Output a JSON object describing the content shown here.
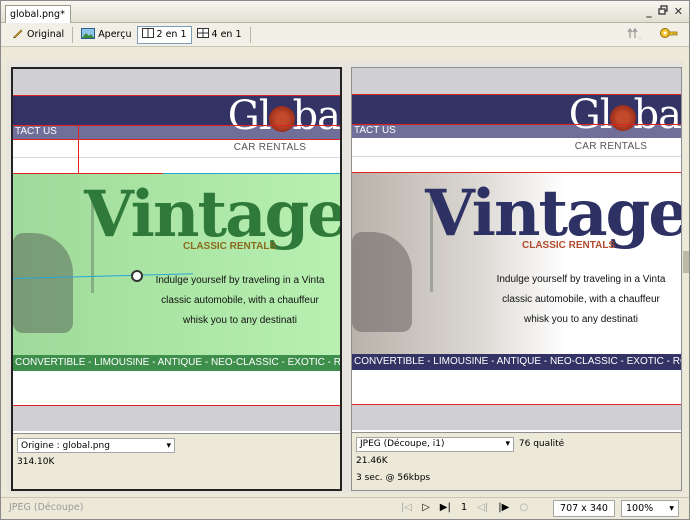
{
  "window": {
    "tab_title": "global.png*",
    "minimize": "-",
    "restore": " ̸",
    "close": "×"
  },
  "toolbar": {
    "original": "Original",
    "apercu": "Aperçu",
    "two_up": "2 en 1",
    "four_up": "4 en 1",
    "active_view": "2 en 1"
  },
  "panes": {
    "left": {
      "format_select": "Origine : global.png",
      "size": "314.10K",
      "quality": "",
      "time": ""
    },
    "right": {
      "format_select": "JPEG (Découpe, i1)",
      "quality": "76 qualité",
      "size": "21.46K",
      "time": "3 sec. @ 56kbps"
    }
  },
  "preview": {
    "logo_prefix": "Gl",
    "logo_suffix": "ba",
    "contact": "TACT US",
    "car_rentals": "CAR RENTALS",
    "vintage": "Vintage",
    "classic": "CLASSIC RENTALS",
    "copy_line1": "Indulge yourself by traveling in a Vinta",
    "copy_line2": "classic automobile, with a chauffeur",
    "copy_line3": "whisk you to any destinati",
    "strip": "CONVERTIBLE - LIMOUSINE - ANTIQUE - NEO-CLASSIC - EXOTIC - ROADST"
  },
  "statusbar": {
    "status": "JPEG (Découpe)",
    "frame": "1",
    "dimensions": "707 x 340",
    "zoom": "100%"
  },
  "colors": {
    "navy": "#333366",
    "green_overlay": "#a9e4a3",
    "slice_lines": "#dd2222"
  }
}
